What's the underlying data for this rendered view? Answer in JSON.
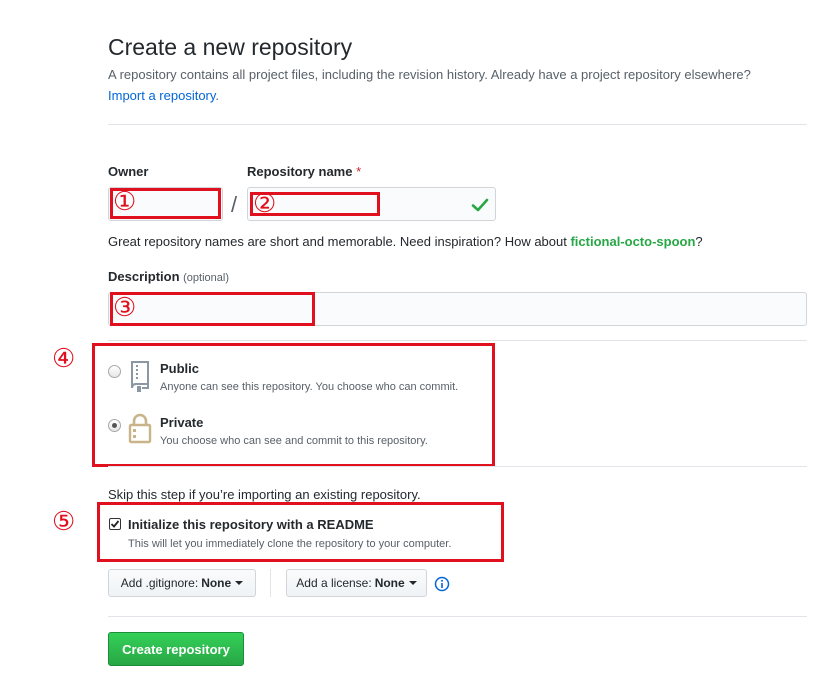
{
  "header": {
    "title": "Create a new repository",
    "subtitle": "A repository contains all project files, including the revision history. Already have a project repository elsewhere?",
    "import_link": "Import a repository",
    "import_suffix": "."
  },
  "owner": {
    "label": "Owner",
    "separator": "/"
  },
  "repo_name": {
    "label": "Repository name",
    "required_mark": "*",
    "valid_icon": "check-icon"
  },
  "hint": {
    "text": "Great repository names are short and memorable. Need inspiration? How about ",
    "suggestion": "fictional-octo-spoon",
    "suffix": "?"
  },
  "description": {
    "label": "Description",
    "optional": "(optional)"
  },
  "visibility": {
    "public": {
      "title": "Public",
      "description": "Anyone can see this repository. You choose who can commit.",
      "icon": "repo-book-icon",
      "checked": false
    },
    "private": {
      "title": "Private",
      "description": "You choose who can see and commit to this repository.",
      "icon": "lock-icon",
      "checked": true
    }
  },
  "init": {
    "skip_text": "Skip this step if you’re importing an existing repository.",
    "readme_label": "Initialize this repository with a README",
    "readme_description": "This will let you immediately clone the repository to your computer.",
    "readme_checked": true
  },
  "selectors": {
    "gitignore_label": "Add .gitignore:",
    "gitignore_value": "None",
    "license_label": "Add a license:",
    "license_value": "None",
    "info_icon": "info-icon"
  },
  "submit": {
    "label": "Create repository"
  },
  "annotations": {
    "n1": "①",
    "n2": "②",
    "n3": "③",
    "n4": "④",
    "n5": "⑤",
    "color": "#e0101e"
  },
  "colors": {
    "link": "#0366d6",
    "success": "#28a745",
    "required": "#cb2431"
  }
}
